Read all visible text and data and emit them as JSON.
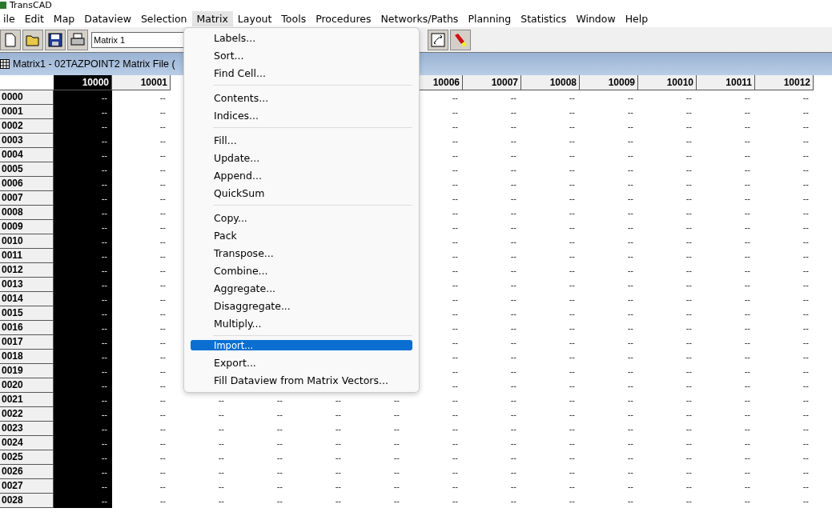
{
  "app_title": "TransCAD",
  "menu_bar": [
    {
      "label": "ile",
      "selected": false
    },
    {
      "label": "Edit",
      "selected": false
    },
    {
      "label": "Map",
      "selected": false
    },
    {
      "label": "Dataview",
      "selected": false
    },
    {
      "label": "Selection",
      "selected": false
    },
    {
      "label": "Matrix",
      "selected": true
    },
    {
      "label": "Layout",
      "selected": false
    },
    {
      "label": "Tools",
      "selected": false
    },
    {
      "label": "Procedures",
      "selected": false
    },
    {
      "label": "Networks/Paths",
      "selected": false
    },
    {
      "label": "Planning",
      "selected": false
    },
    {
      "label": "Statistics",
      "selected": false
    },
    {
      "label": "Window",
      "selected": false
    },
    {
      "label": "Help",
      "selected": false
    }
  ],
  "toolbar": {
    "matrix_field": "Matrix 1"
  },
  "matrix_window": {
    "title": "Matrix1 - 02TAZPOINT2 Matrix File (",
    "columns": [
      {
        "label": "10000",
        "selected": true
      },
      {
        "label": "10001",
        "selected": false
      },
      null,
      null,
      null,
      null,
      {
        "label": "10006",
        "selected": false
      },
      {
        "label": "10007",
        "selected": false
      },
      {
        "label": "10008",
        "selected": false
      },
      {
        "label": "10009",
        "selected": false
      },
      {
        "label": "10010",
        "selected": false
      },
      {
        "label": "10011",
        "selected": false
      },
      {
        "label": "10012",
        "selected": false
      }
    ],
    "rows": [
      {
        "label": "0000",
        "cells": [
          "--",
          "--",
          null,
          null,
          null,
          null,
          "--",
          "--",
          "--",
          "--",
          "--",
          "--",
          "--"
        ]
      },
      {
        "label": "0001",
        "cells": [
          "--",
          "--",
          null,
          null,
          null,
          null,
          "--",
          "--",
          "--",
          "--",
          "--",
          "--",
          "--"
        ]
      },
      {
        "label": "0002",
        "cells": [
          "--",
          "--",
          null,
          null,
          null,
          null,
          "--",
          "--",
          "--",
          "--",
          "--",
          "--",
          "--"
        ]
      },
      {
        "label": "0003",
        "cells": [
          "--",
          "--",
          null,
          null,
          null,
          null,
          "--",
          "--",
          "--",
          "--",
          "--",
          "--",
          "--"
        ]
      },
      {
        "label": "0004",
        "cells": [
          "--",
          "--",
          null,
          null,
          null,
          null,
          "--",
          "--",
          "--",
          "--",
          "--",
          "--",
          "--"
        ]
      },
      {
        "label": "0005",
        "cells": [
          "--",
          "--",
          null,
          null,
          null,
          null,
          "--",
          "--",
          "--",
          "--",
          "--",
          "--",
          "--"
        ]
      },
      {
        "label": "0006",
        "cells": [
          "--",
          "--",
          null,
          null,
          null,
          null,
          "--",
          "--",
          "--",
          "--",
          "--",
          "--",
          "--"
        ]
      },
      {
        "label": "0007",
        "cells": [
          "--",
          "--",
          null,
          null,
          null,
          null,
          "--",
          "--",
          "--",
          "--",
          "--",
          "--",
          "--"
        ]
      },
      {
        "label": "0008",
        "cells": [
          "--",
          "--",
          null,
          null,
          null,
          null,
          "--",
          "--",
          "--",
          "--",
          "--",
          "--",
          "--"
        ]
      },
      {
        "label": "0009",
        "cells": [
          "--",
          "--",
          null,
          null,
          null,
          null,
          "--",
          "--",
          "--",
          "--",
          "--",
          "--",
          "--"
        ]
      },
      {
        "label": "0010",
        "cells": [
          "--",
          "--",
          null,
          null,
          null,
          null,
          "--",
          "--",
          "--",
          "--",
          "--",
          "--",
          "--"
        ]
      },
      {
        "label": "0011",
        "cells": [
          "--",
          "--",
          null,
          null,
          null,
          null,
          "--",
          "--",
          "--",
          "--",
          "--",
          "--",
          "--"
        ]
      },
      {
        "label": "0012",
        "cells": [
          "--",
          "--",
          null,
          null,
          null,
          null,
          "--",
          "--",
          "--",
          "--",
          "--",
          "--",
          "--"
        ]
      },
      {
        "label": "0013",
        "cells": [
          "--",
          "--",
          null,
          null,
          null,
          null,
          "--",
          "--",
          "--",
          "--",
          "--",
          "--",
          "--"
        ]
      },
      {
        "label": "0014",
        "cells": [
          "--",
          "--",
          null,
          null,
          null,
          null,
          "--",
          "--",
          "--",
          "--",
          "--",
          "--",
          "--"
        ]
      },
      {
        "label": "0015",
        "cells": [
          "--",
          "--",
          null,
          null,
          null,
          null,
          "--",
          "--",
          "--",
          "--",
          "--",
          "--",
          "--"
        ]
      },
      {
        "label": "0016",
        "cells": [
          "--",
          "--",
          null,
          null,
          null,
          null,
          "--",
          "--",
          "--",
          "--",
          "--",
          "--",
          "--"
        ]
      },
      {
        "label": "0017",
        "cells": [
          "--",
          "--",
          null,
          null,
          null,
          null,
          "--",
          "--",
          "--",
          "--",
          "--",
          "--",
          "--"
        ]
      },
      {
        "label": "0018",
        "cells": [
          "--",
          "--",
          null,
          null,
          null,
          null,
          "--",
          "--",
          "--",
          "--",
          "--",
          "--",
          "--"
        ]
      },
      {
        "label": "0019",
        "cells": [
          "--",
          "--",
          null,
          null,
          null,
          null,
          "--",
          "--",
          "--",
          "--",
          "--",
          "--",
          "--"
        ]
      },
      {
        "label": "0020",
        "cells": [
          "--",
          "--",
          null,
          null,
          null,
          null,
          "--",
          "--",
          "--",
          "--",
          "--",
          "--",
          "--"
        ]
      },
      {
        "label": "0021",
        "cells": [
          "--",
          "--",
          "--",
          "--",
          "--",
          "--",
          "--",
          "--",
          "--",
          "--",
          "--",
          "--",
          "--"
        ]
      },
      {
        "label": "0022",
        "cells": [
          "--",
          "--",
          "--",
          "--",
          "--",
          "--",
          "--",
          "--",
          "--",
          "--",
          "--",
          "--",
          "--"
        ]
      },
      {
        "label": "0023",
        "cells": [
          "--",
          "--",
          "--",
          "--",
          "--",
          "--",
          "--",
          "--",
          "--",
          "--",
          "--",
          "--",
          "--"
        ]
      },
      {
        "label": "0024",
        "cells": [
          "--",
          "--",
          "--",
          "--",
          "--",
          "--",
          "--",
          "--",
          "--",
          "--",
          "--",
          "--",
          "--"
        ]
      },
      {
        "label": "0025",
        "cells": [
          "--",
          "--",
          "--",
          "--",
          "--",
          "--",
          "--",
          "--",
          "--",
          "--",
          "--",
          "--",
          "--"
        ]
      },
      {
        "label": "0026",
        "cells": [
          "--",
          "--",
          "--",
          "--",
          "--",
          "--",
          "--",
          "--",
          "--",
          "--",
          "--",
          "--",
          "--"
        ]
      },
      {
        "label": "0027",
        "cells": [
          "--",
          "--",
          "--",
          "--",
          "--",
          "--",
          "--",
          "--",
          "--",
          "--",
          "--",
          "--",
          "--"
        ]
      },
      {
        "label": "0028",
        "cells": [
          "--",
          "--",
          "--",
          "--",
          "--",
          "--",
          "--",
          "--",
          "--",
          "--",
          "--",
          "--",
          "--"
        ]
      }
    ]
  },
  "matrix_menu": {
    "groups": [
      [
        {
          "label": "Labels...",
          "selected": false
        },
        {
          "label": "Sort...",
          "selected": false
        },
        {
          "label": "Find Cell...",
          "selected": false
        }
      ],
      [
        {
          "label": "Contents...",
          "selected": false
        },
        {
          "label": "Indices...",
          "selected": false
        }
      ],
      [
        {
          "label": "Fill...",
          "selected": false
        },
        {
          "label": "Update...",
          "selected": false
        },
        {
          "label": "Append...",
          "selected": false
        },
        {
          "label": "QuickSum",
          "selected": false
        }
      ],
      [
        {
          "label": "Copy...",
          "selected": false
        },
        {
          "label": "Pack",
          "selected": false
        },
        {
          "label": "Transpose...",
          "selected": false
        },
        {
          "label": "Combine...",
          "selected": false
        },
        {
          "label": "Aggregate...",
          "selected": false
        },
        {
          "label": "Disaggregate...",
          "selected": false
        },
        {
          "label": "Multiply...",
          "selected": false
        }
      ],
      [
        {
          "label": "Import...",
          "selected": true
        },
        {
          "label": "Export...",
          "selected": false
        },
        {
          "label": "Fill Dataview from Matrix Vectors...",
          "selected": false
        }
      ]
    ]
  }
}
